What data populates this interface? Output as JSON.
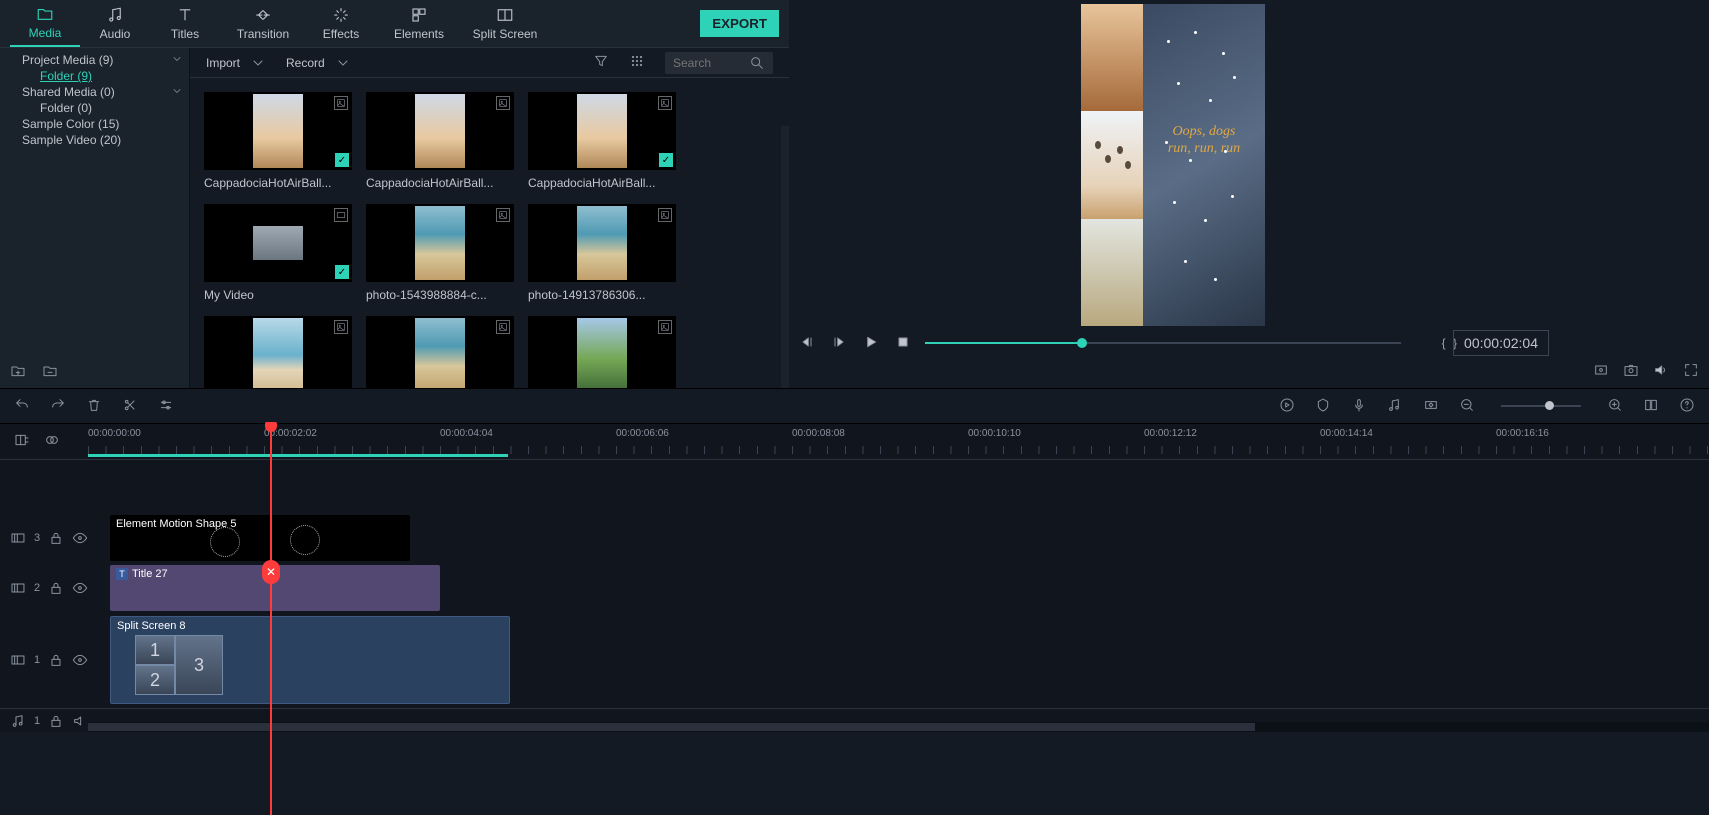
{
  "tabs": {
    "media": "Media",
    "audio": "Audio",
    "titles": "Titles",
    "transition": "Transition",
    "effects": "Effects",
    "elements": "Elements",
    "split": "Split Screen",
    "export": "EXPORT"
  },
  "tree": {
    "items": [
      {
        "label": "Project Media (9)",
        "expandable": true
      },
      {
        "label": "Folder (9)",
        "indent": true,
        "link": true
      },
      {
        "label": "Shared Media (0)",
        "expandable": true
      },
      {
        "label": "Folder (0)",
        "indent": true
      },
      {
        "label": "Sample Color (15)"
      },
      {
        "label": "Sample Video (20)"
      }
    ]
  },
  "toolbar": {
    "import": "Import",
    "record": "Record",
    "searchPH": "Search"
  },
  "media": {
    "items": [
      {
        "name": "CappadociaHotAirBall...",
        "style": "sky-grad",
        "check": true,
        "type": "img"
      },
      {
        "name": "CappadociaHotAirBall...",
        "style": "sky-grad",
        "check": false,
        "type": "img"
      },
      {
        "name": "CappadociaHotAirBall...",
        "style": "sky-grad",
        "check": true,
        "type": "img"
      },
      {
        "name": "My Video",
        "style": "vid-grad",
        "check": true,
        "type": "vid"
      },
      {
        "name": "photo-1543988884-c...",
        "style": "sea-grad",
        "check": false,
        "type": "img"
      },
      {
        "name": "photo-14913786306...",
        "style": "sea-grad",
        "check": false,
        "type": "img"
      },
      {
        "name": "",
        "style": "shore-grad",
        "check": false,
        "type": "img"
      },
      {
        "name": "",
        "style": "sea-grad",
        "check": false,
        "type": "img"
      },
      {
        "name": "",
        "style": "palm-grad",
        "check": false,
        "type": "img"
      }
    ]
  },
  "preview": {
    "textLine1": "Oops, dogs",
    "textLine2": "run, run, run",
    "timecode": "00:00:02:04",
    "markers": "{   }"
  },
  "timeline": {
    "ruler": [
      "00:00:00:00",
      "00:00:02:02",
      "00:00:04:04",
      "00:00:06:06",
      "00:00:08:08",
      "00:00:10:10",
      "00:00:12:12",
      "00:00:14:14",
      "00:00:16:16"
    ],
    "tracks": {
      "t3": "3",
      "t2": "2",
      "t1_2": "1",
      "t1": "1",
      "a1": "1"
    },
    "clips": {
      "effect": "Element Motion Shape 5",
      "title": "Title 27",
      "video": "Split Screen 8",
      "ss": [
        "1",
        "2",
        "3"
      ]
    }
  },
  "icons": {
    "video": "▣",
    "image": "▦",
    "lock": "🔒",
    "eye": "👁"
  }
}
